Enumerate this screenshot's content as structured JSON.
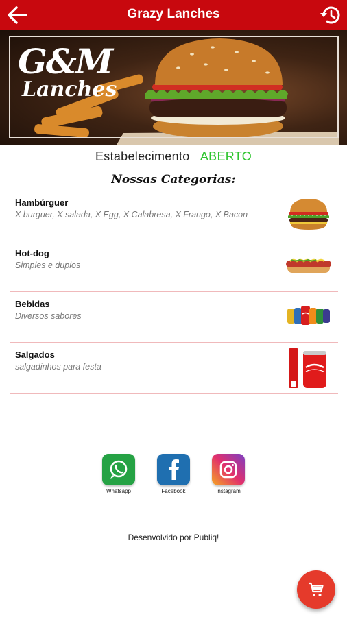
{
  "appbar": {
    "title": "Grazy Lanches",
    "back_icon": "arrow-back-icon",
    "history_icon": "history-icon"
  },
  "banner": {
    "logo_initials": "G&M",
    "logo_word": "Lanches"
  },
  "status": {
    "label": "Estabelecimento",
    "value": "ABERTO",
    "value_color": "#2ec52e"
  },
  "categories_title": "Nossas Categorias:",
  "categories": [
    {
      "name": "Hambúrguer",
      "description": "X burguer, X salada, X Egg, X Calabresa, X Frango, X Bacon",
      "image_icon": "hamburger-icon"
    },
    {
      "name": "Hot-dog",
      "description": "Simples e duplos",
      "image_icon": "hotdog-icon"
    },
    {
      "name": "Bebidas",
      "description": "Diversos sabores",
      "image_icon": "soda-cans-icon"
    },
    {
      "name": "Salgados",
      "description": "salgadinhos para festa",
      "image_icon": "coca-cola-can-icon"
    }
  ],
  "social": [
    {
      "label": "Whatsapp",
      "icon": "whatsapp-icon",
      "color": "#25a244"
    },
    {
      "label": "Facebook",
      "icon": "facebook-icon",
      "color": "#1f6fb0"
    },
    {
      "label": "Instagram",
      "icon": "instagram-icon",
      "color": "#c4368f"
    }
  ],
  "credit": "Desenvolvido por Publiq!",
  "cart_icon": "cart-icon",
  "colors": {
    "primary": "#c8080e",
    "divider": "#f0b9bb",
    "fab": "#e53a2b"
  }
}
